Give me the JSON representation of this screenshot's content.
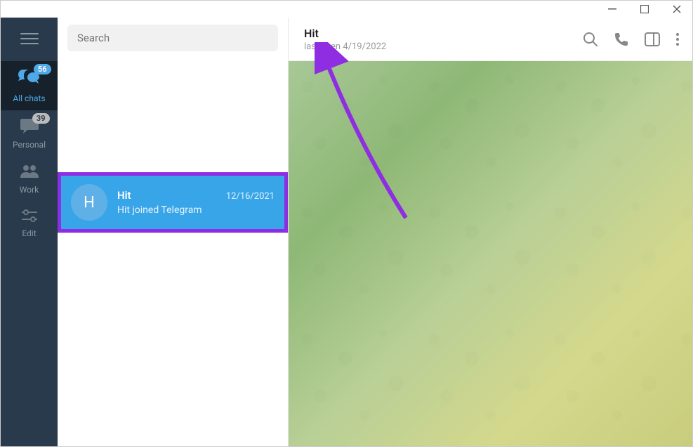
{
  "search": {
    "placeholder": "Search"
  },
  "sidebar": {
    "items": [
      {
        "label": "All chats",
        "badge": "56"
      },
      {
        "label": "Personal",
        "badge": "39"
      },
      {
        "label": "Work"
      },
      {
        "label": "Edit"
      }
    ]
  },
  "chatlist": {
    "items": [
      {
        "avatar_letter": "H",
        "name": "Hit",
        "date": "12/16/2021",
        "preview": "Hit joined Telegram"
      }
    ]
  },
  "chat_header": {
    "name": "Hit",
    "status": "last seen 4/19/2022"
  }
}
